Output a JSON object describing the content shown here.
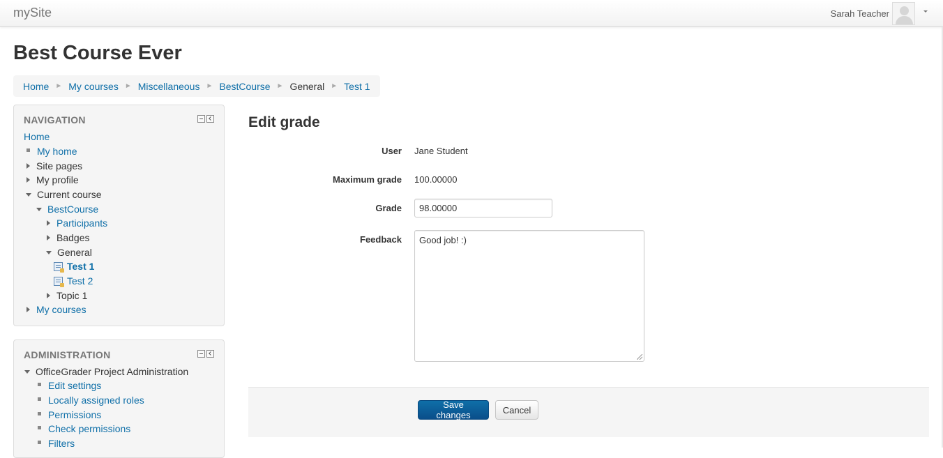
{
  "navbar": {
    "brand": "mySite",
    "user_name": "Sarah Teacher"
  },
  "page": {
    "title": "Best Course Ever"
  },
  "breadcrumb": {
    "items": [
      "Home",
      "My courses",
      "Miscellaneous",
      "BestCourse",
      "General",
      "Test 1"
    ],
    "separator": "►"
  },
  "navigation_block": {
    "title": "NAVIGATION",
    "items": [
      {
        "label": "Home",
        "icon": "none",
        "link": true
      },
      {
        "label": "My home",
        "icon": "bullet",
        "link": true
      },
      {
        "label": "Site pages",
        "icon": "collapsed-arrow",
        "link": false
      },
      {
        "label": "My profile",
        "icon": "collapsed-arrow",
        "link": false
      },
      {
        "label": "Current course",
        "icon": "expanded-arrow",
        "link": false
      },
      {
        "label": "BestCourse",
        "icon": "expanded-arrow",
        "link": true
      },
      {
        "label": "Participants",
        "icon": "collapsed-arrow",
        "link": true
      },
      {
        "label": "Badges",
        "icon": "collapsed-arrow",
        "link": false
      },
      {
        "label": "General",
        "icon": "expanded-arrow",
        "link": false
      },
      {
        "label": "Test 1",
        "icon": "quiz-icon",
        "link": true
      },
      {
        "label": "Test 2",
        "icon": "quiz-icon",
        "link": true
      },
      {
        "label": "Topic 1",
        "icon": "collapsed-arrow",
        "link": false
      },
      {
        "label": "My courses",
        "icon": "collapsed-arrow",
        "link": true
      }
    ]
  },
  "administration_block": {
    "title": "ADMINISTRATION",
    "items": [
      {
        "label": "OfficeGrader Project Administration",
        "icon": "expanded-arrow",
        "link": false
      },
      {
        "label": "Edit settings",
        "icon": "bullet",
        "link": true
      },
      {
        "label": "Locally assigned roles",
        "icon": "bullet",
        "link": true
      },
      {
        "label": "Permissions",
        "icon": "bullet",
        "link": true
      },
      {
        "label": "Check permissions",
        "icon": "bullet",
        "link": true
      },
      {
        "label": "Filters",
        "icon": "bullet",
        "link": true
      }
    ]
  },
  "edit_grade": {
    "title": "Edit grade",
    "user_label": "User",
    "user_value": "Jane Student",
    "max_grade_label": "Maximum grade",
    "max_grade_value": "100.00000",
    "grade_label": "Grade",
    "grade_value": "98.00000",
    "feedback_label": "Feedback",
    "feedback_value": "Good job! :)"
  },
  "actions": {
    "save_label": "Save changes",
    "cancel_label": "Cancel"
  },
  "colors": {
    "link": "#0f6fa8",
    "primary_button": "#0f6fa8",
    "block_background": "#f5f5f5"
  }
}
